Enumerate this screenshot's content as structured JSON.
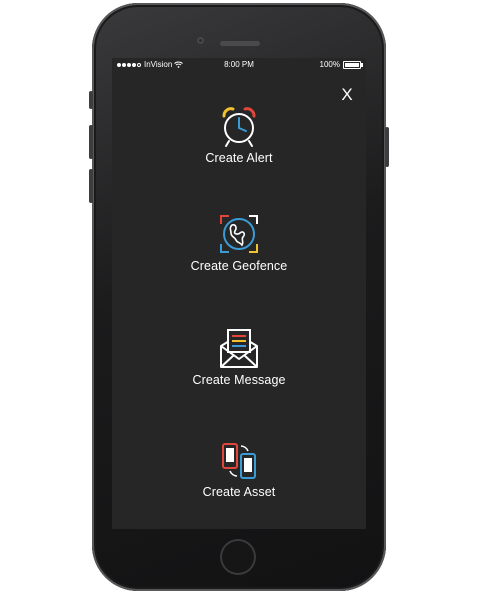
{
  "status_bar": {
    "carrier": "InVision",
    "time": "8:00 PM",
    "battery": "100%"
  },
  "close_label": "X",
  "menu": [
    {
      "label": "Create Alert",
      "icon": "alarm-clock-icon"
    },
    {
      "label": "Create Geofence",
      "icon": "globe-frame-icon"
    },
    {
      "label": "Create Message",
      "icon": "envelope-letter-icon"
    },
    {
      "label": "Create Asset",
      "icon": "mobile-devices-icon"
    }
  ],
  "colors": {
    "screen_bg": "#262627",
    "accent_red": "#e2463a",
    "accent_yellow": "#f2c12e",
    "accent_blue": "#3a9bd6",
    "line_white": "#ffffff"
  }
}
